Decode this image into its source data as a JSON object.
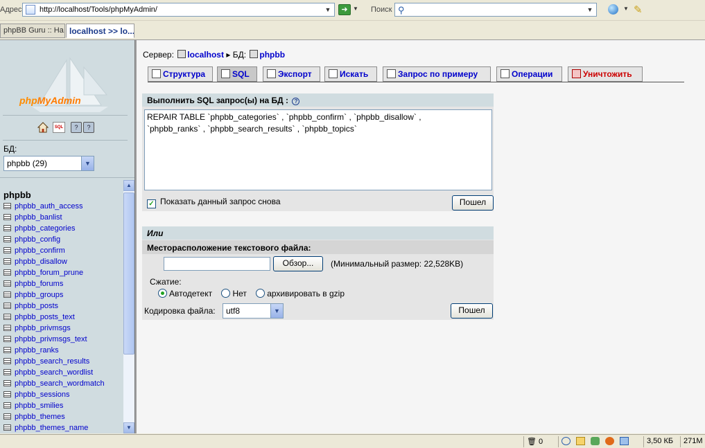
{
  "browser": {
    "address_label": "Адрес",
    "url": "http://localhost/Tools/phpMyAdmin/",
    "search_label": "Поиск",
    "tabs": [
      {
        "label": "phpBB Guru :: На..."
      },
      {
        "label": "localhost >> lo..."
      }
    ]
  },
  "left": {
    "logo_text_php": "php",
    "logo_text_myadmin": "MyAdmin",
    "db_label": "БД:",
    "db_select_value": "phpbb (29)",
    "db_name": "phpbb",
    "tables": [
      "phpbb_auth_access",
      "phpbb_banlist",
      "phpbb_categories",
      "phpbb_config",
      "phpbb_confirm",
      "phpbb_disallow",
      "phpbb_forum_prune",
      "phpbb_forums",
      "phpbb_groups",
      "phpbb_posts",
      "phpbb_posts_text",
      "phpbb_privmsgs",
      "phpbb_privmsgs_text",
      "phpbb_ranks",
      "phpbb_search_results",
      "phpbb_search_wordlist",
      "phpbb_search_wordmatch",
      "phpbb_sessions",
      "phpbb_smilies",
      "phpbb_themes",
      "phpbb_themes_name"
    ]
  },
  "main": {
    "server_label": "Сервер:",
    "server_name": "localhost",
    "db_label": "БД:",
    "db_name": "phpbb",
    "tabs": [
      {
        "label": "Структура"
      },
      {
        "label": "SQL"
      },
      {
        "label": "Экспорт"
      },
      {
        "label": "Искать"
      },
      {
        "label": "Запрос по примеру"
      },
      {
        "label": "Операции"
      },
      {
        "label": "Уничтожить"
      }
    ],
    "sql_header": "Выполнить SQL запрос(ы) на БД :",
    "sql_text": "REPAIR TABLE `phpbb_categories` , `phpbb_confirm` , `phpbb_disallow` ,\n`phpbb_ranks` , `phpbb_search_results` , `phpbb_topics`",
    "show_again_label": "Показать данный запрос снова",
    "go_label": "Пошел",
    "or_label": "Или",
    "file_location_label": "Месторасположение текстового файла:",
    "browse_label": "Обзор...",
    "max_size_text": "(Минимальный размер: 22,528KB)",
    "compression_label": "Сжатие:",
    "compression_options": [
      "Автодетект",
      "Нет",
      "архивировать в gzip"
    ],
    "encoding_label": "Кодировка файла:",
    "encoding_value": "utf8",
    "go2_label": "Пошел"
  },
  "status": {
    "trash_count": "0",
    "page_size": "3,50 КБ",
    "memory": "271M"
  }
}
